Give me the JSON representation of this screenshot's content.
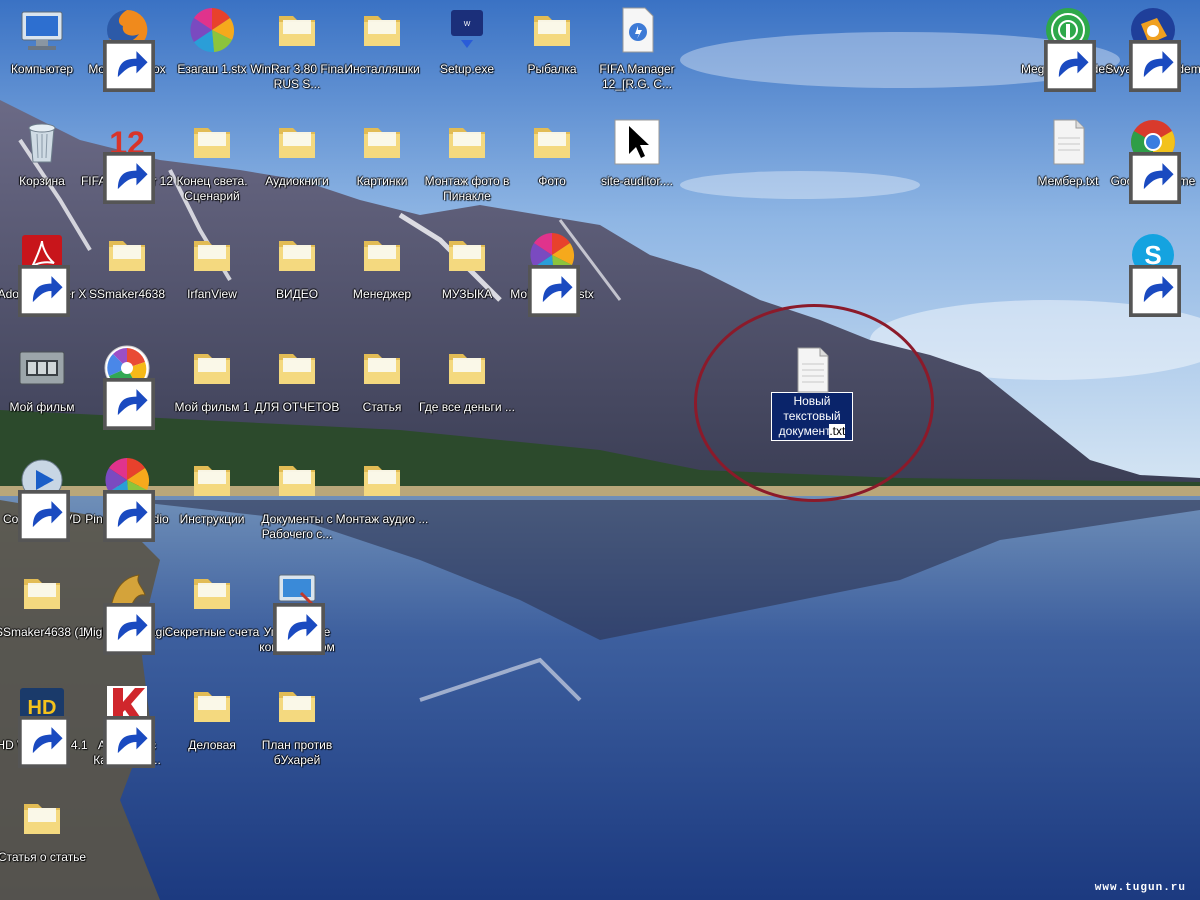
{
  "colors": {
    "sky_top": "#3a78c8",
    "sky_bottom": "#b8d4ee",
    "mountain": "#4a4a6a",
    "lake": "#2a4c8c",
    "folder": "#f1d27a",
    "selection": "#0a246a",
    "circle": "#8b1a2a"
  },
  "icons": [
    {
      "label": "Компьютер",
      "icon": "computer-icon"
    },
    {
      "label": "Mozilla Firefox",
      "icon": "firefox-icon"
    },
    {
      "label": "Езагаш 1.stx",
      "icon": "pinwheel-icon"
    },
    {
      "label": "WinRar 3.80 Fina RUS S...",
      "icon": "folder-icon"
    },
    {
      "label": "Инсталляшки",
      "icon": "folder-icon"
    },
    {
      "label": "Setup.exe",
      "icon": "walkman-icon"
    },
    {
      "label": "Рыбалка",
      "icon": "folder-icon"
    },
    {
      "label": "FIFA Manager 12_[R.G. C...",
      "icon": "document-icon"
    },
    {
      "label": "MegaFon Modem",
      "icon": "megafon-icon"
    },
    {
      "label": "Svyaznoy Modem",
      "icon": "svyaznoy-icon"
    },
    {
      "label": "Корзина",
      "icon": "recycle-bin-icon"
    },
    {
      "label": "FIFA Manager 12",
      "icon": "fifa-12-icon"
    },
    {
      "label": "Конец света. Сценарий",
      "icon": "folder-icon"
    },
    {
      "label": "Аудиокниги",
      "icon": "folder-icon"
    },
    {
      "label": "Картинки",
      "icon": "folder-icon"
    },
    {
      "label": "Монтаж фото в Пинакле",
      "icon": "folder-icon"
    },
    {
      "label": "Фото",
      "icon": "folder-icon"
    },
    {
      "label": "site-auditor....",
      "icon": "cursor-icon"
    },
    {
      "label": "Мембер.txt",
      "icon": "text-file-icon"
    },
    {
      "label": "Google Chrome",
      "icon": "chrome-icon"
    },
    {
      "label": "Adobe Reader X",
      "icon": "adobe-reader-icon"
    },
    {
      "label": "SSmaker4638",
      "icon": "folder-icon"
    },
    {
      "label": "IrfanView",
      "icon": "folder-icon"
    },
    {
      "label": "ВИДЕО",
      "icon": "folder-icon"
    },
    {
      "label": "Менеджер",
      "icon": "folder-icon"
    },
    {
      "label": "МУЗЫКА",
      "icon": "folder-icon"
    },
    {
      "label": "Мой фильм.stx",
      "icon": "pinwheel-icon"
    },
    {
      "label": "Skype",
      "icon": "skype-icon"
    },
    {
      "label": "Мой фильм",
      "icon": "film-icon"
    },
    {
      "label": "Picasa 3",
      "icon": "picasa-icon"
    },
    {
      "label": "Мой фильм 1",
      "icon": "folder-icon"
    },
    {
      "label": "ДЛЯ ОТЧЕТОВ",
      "icon": "folder-icon"
    },
    {
      "label": "Статья",
      "icon": "folder-icon"
    },
    {
      "label": "Где все деньги ...",
      "icon": "folder-icon"
    },
    {
      "label": "Corel WinDVD 2010",
      "icon": "windvd-icon"
    },
    {
      "label": "Pinnacle Studio 14",
      "icon": "pinwheel-icon"
    },
    {
      "label": "Инструкции",
      "icon": "folder-icon"
    },
    {
      "label": "Документы с Рабочего с...",
      "icon": "folder-icon"
    },
    {
      "label": "Монтаж аудио ...",
      "icon": "folder-icon"
    },
    {
      "label": "SSmaker4638 (1)",
      "icon": "folder-icon"
    },
    {
      "label": "Might and Magic Hero...",
      "icon": "griffin-icon"
    },
    {
      "label": "Секретные счета",
      "icon": "folder-icon"
    },
    {
      "label": "Управление компьютером",
      "icon": "computer-management-icon"
    },
    {
      "label": "HD Writer AE 4.1",
      "icon": "hd-writer-icon"
    },
    {
      "label": "Антивирус Касперско...",
      "icon": "kaspersky-icon"
    },
    {
      "label": "Деловая",
      "icon": "folder-icon"
    },
    {
      "label": "План против бУхарей",
      "icon": "folder-icon"
    },
    {
      "label": "Статья о статье",
      "icon": "folder-icon"
    }
  ],
  "selected_file": {
    "name_selected": "Новый текстовый документ",
    "extension": ".txt",
    "icon": "text-file-icon"
  },
  "watermark": "www.tugun.ru"
}
